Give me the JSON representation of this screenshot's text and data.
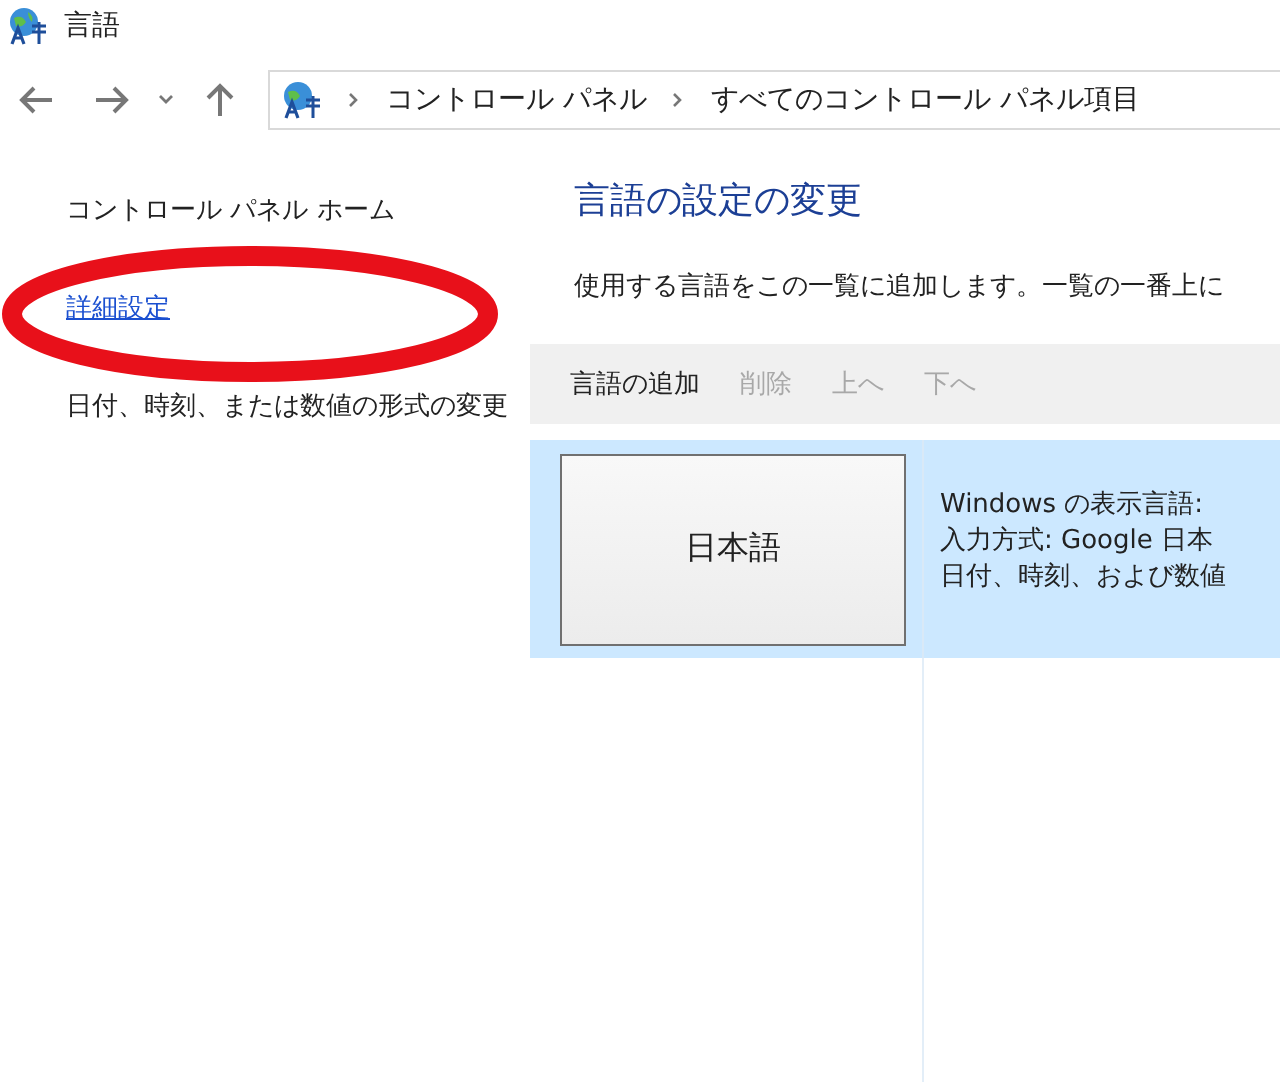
{
  "window": {
    "title": "言語"
  },
  "nav": {
    "back_disabled": false,
    "forward_disabled": false
  },
  "breadcrumbs": [
    "コントロール パネル",
    "すべてのコントロール パネル項目"
  ],
  "sidebar": {
    "items": [
      {
        "label": "コントロール パネル ホーム",
        "kind": "plain"
      },
      {
        "label": "詳細設定",
        "kind": "link"
      },
      {
        "label": "日付、時刻、または数値の形式の変更",
        "kind": "plain"
      }
    ]
  },
  "main": {
    "heading": "言語の設定の変更",
    "description": "使用する言語をこの一覧に追加します。一覧の一番上に",
    "toolbar": [
      {
        "label": "言語の追加",
        "disabled": false
      },
      {
        "label": "削除",
        "disabled": true
      },
      {
        "label": "上へ",
        "disabled": true
      },
      {
        "label": "下へ",
        "disabled": true
      }
    ],
    "languages": [
      {
        "name": "日本語",
        "selected": true,
        "details": [
          "Windows の表示言語: ",
          "入力方式: Google 日本",
          "日付、時刻、および数値"
        ]
      }
    ]
  },
  "annotation": {
    "kind": "ellipse",
    "color": "#e8101a"
  }
}
